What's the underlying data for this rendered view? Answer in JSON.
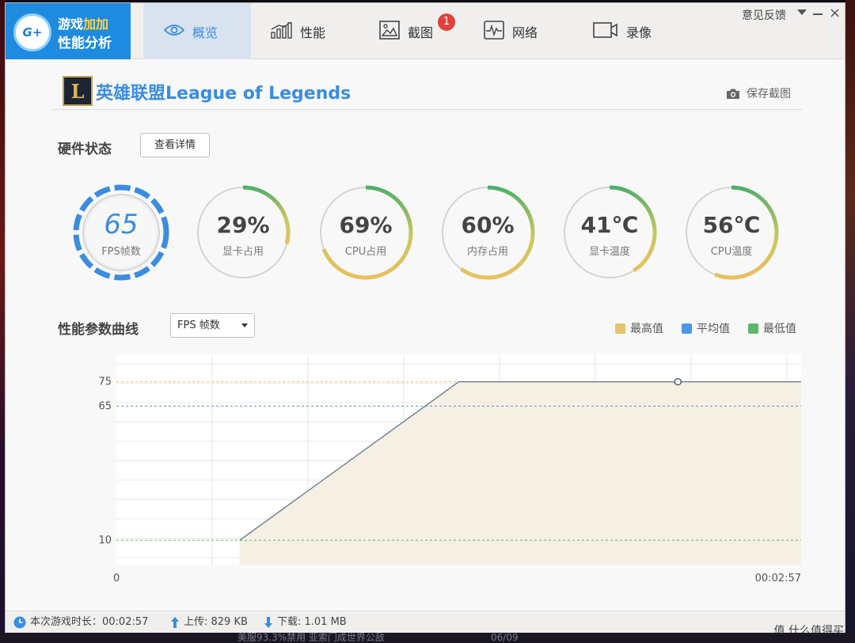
{
  "logo": {
    "mark": "G+",
    "line1_a": "游戏",
    "line1_b": "加加",
    "line2": "性能分析"
  },
  "tabs": [
    {
      "label": "概览",
      "icon": "eye-icon",
      "active": true
    },
    {
      "label": "性能",
      "icon": "bar-chart-icon"
    },
    {
      "label": "截图",
      "icon": "image-icon",
      "badge": "1"
    },
    {
      "label": "网络",
      "icon": "pulse-icon"
    },
    {
      "label": "录像",
      "icon": "video-camera-icon"
    }
  ],
  "window": {
    "feedback": "意见反馈"
  },
  "game": {
    "icon_letter": "L",
    "title": "英雄联盟League of Legends",
    "save_screenshot": "保存截图"
  },
  "hardware": {
    "title": "硬件状态",
    "detail_button": "查看详情",
    "gauges": [
      {
        "value": "65",
        "label": "FPS帧数",
        "kind": "fps"
      },
      {
        "value": "29%",
        "label": "显卡占用",
        "fraction": 0.29
      },
      {
        "value": "69%",
        "label": "CPU占用",
        "fraction": 0.69
      },
      {
        "value": "60%",
        "label": "内存占用",
        "fraction": 0.6
      },
      {
        "value": "41℃",
        "label": "显卡温度",
        "fraction": 0.41
      },
      {
        "value": "56℃",
        "label": "CPU温度",
        "fraction": 0.56
      }
    ]
  },
  "curves": {
    "title": "性能参数曲线",
    "select_value": "FPS 帧数",
    "legend": [
      {
        "label": "最高值",
        "color": "#e5c46a"
      },
      {
        "label": "平均值",
        "color": "#4d96e8"
      },
      {
        "label": "最低值",
        "color": "#5cb86a"
      }
    ]
  },
  "chart_data": {
    "type": "area",
    "x_start_label": "0",
    "x_end_label": "00:02:57",
    "y_ticks": [
      "75",
      "65",
      "10"
    ],
    "reference_lines": {
      "max": 75,
      "avg": 65,
      "min": 10
    },
    "series": [
      {
        "values": [
          10,
          75,
          75,
          75
        ]
      }
    ],
    "x": [
      0.18,
      0.5,
      0.82,
      1.0
    ]
  },
  "status": {
    "duration": "本次游戏时长：00:02:57",
    "upload": "上传: 829 KB",
    "download": "下载: 1.01 MB"
  },
  "background": {
    "news": "美服93.3%禁用 亚索门成世界公敌",
    "date": "06/09"
  },
  "watermark": "值 什么值得买"
}
